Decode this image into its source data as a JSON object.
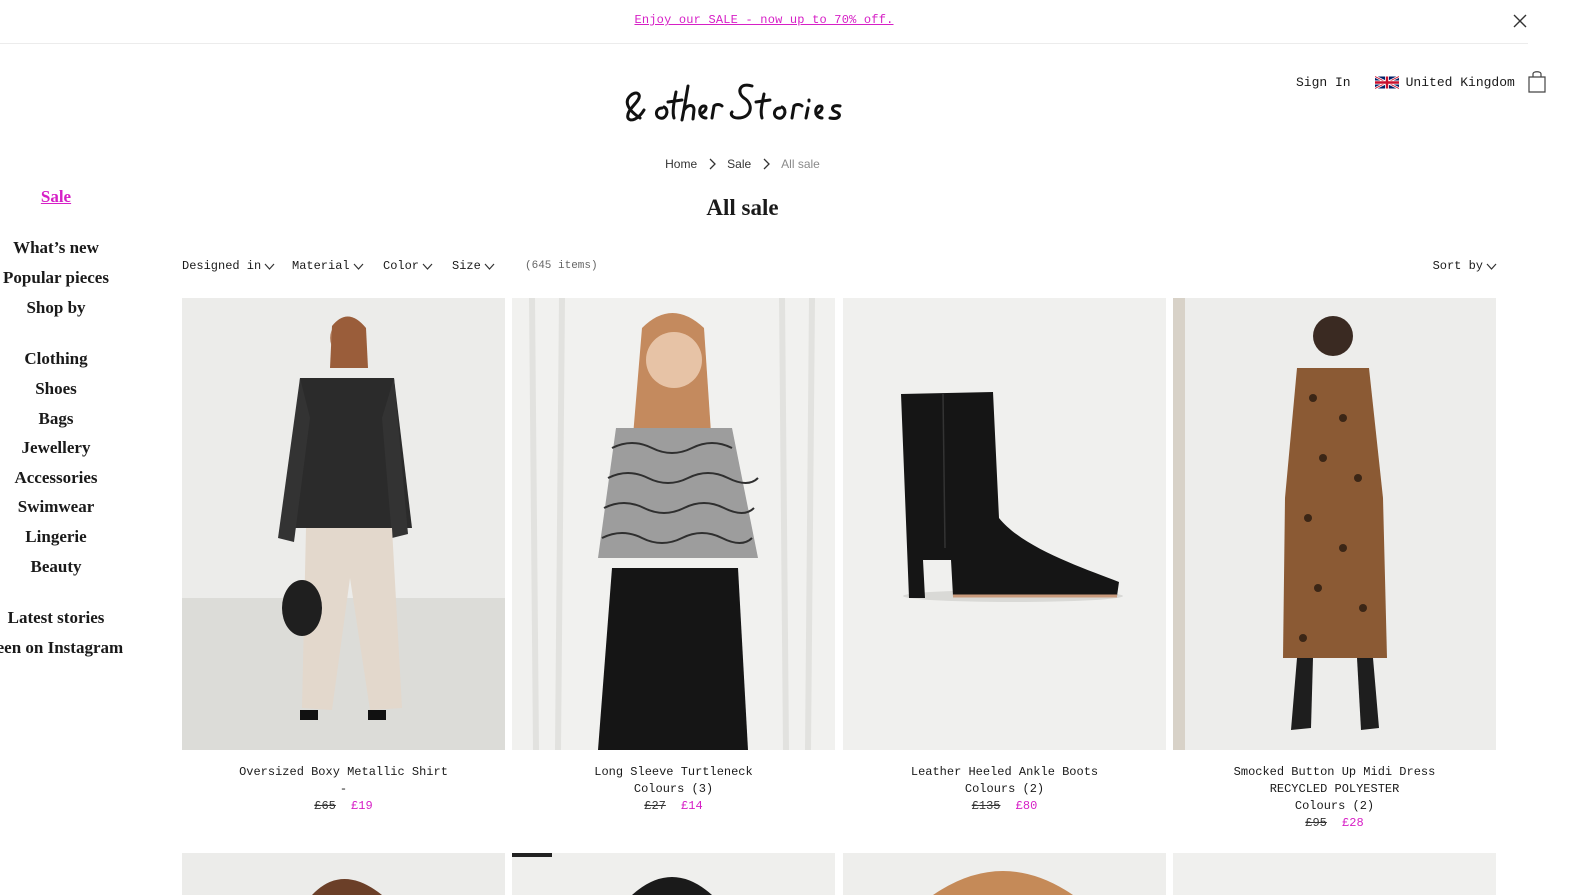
{
  "banner": {
    "text": "Enjoy our SALE - now up to 70% off."
  },
  "header": {
    "logo_text": "& other Stories",
    "sign_in": "Sign In",
    "country": "United Kingdom"
  },
  "breadcrumb": [
    {
      "label": "Home"
    },
    {
      "label": "Sale"
    },
    {
      "label": "All sale"
    }
  ],
  "page_title": "All sale",
  "sidebar": {
    "items": [
      {
        "label": "Sale"
      },
      {
        "label": "What’s new"
      },
      {
        "label": "Popular pieces"
      },
      {
        "label": "Shop by"
      },
      {
        "label": "Clothing"
      },
      {
        "label": "Shoes"
      },
      {
        "label": "Bags"
      },
      {
        "label": "Jewellery"
      },
      {
        "label": "Accessories"
      },
      {
        "label": "Swimwear"
      },
      {
        "label": "Lingerie"
      },
      {
        "label": "Beauty"
      },
      {
        "label": "Latest stories"
      },
      {
        "label": "seen on Instagram"
      }
    ]
  },
  "filters": {
    "designed_in": "Designed in",
    "material": "Material",
    "color": "Color",
    "size": "Size",
    "item_count": "(645 items)",
    "sort_by": "Sort by"
  },
  "products": [
    {
      "name": "Oversized Boxy Metallic Shirt",
      "detail": "-",
      "price_old": "£65",
      "price_new": "£19"
    },
    {
      "name": "Long Sleeve Turtleneck",
      "detail": "Colours (3)",
      "price_old": "£27",
      "price_new": "£14"
    },
    {
      "name": "Leather Heeled Ankle Boots",
      "detail": "Colours (2)",
      "price_old": "£135",
      "price_new": "£80"
    },
    {
      "name": "Smocked Button Up Midi Dress",
      "detail": "RECYCLED POLYESTER",
      "detail2": "Colours (2)",
      "price_old": "£95",
      "price_new": "£28"
    }
  ],
  "colors": {
    "accent": "#d61fc6",
    "text": "#1a1a1a",
    "muted": "#8a8a8a"
  }
}
